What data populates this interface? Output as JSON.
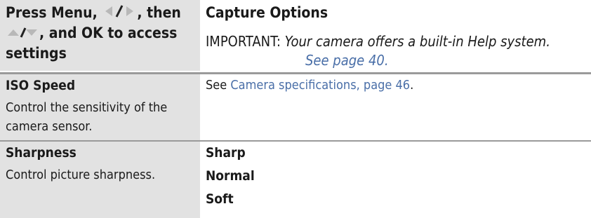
{
  "header": {
    "left_title_1": "Press Menu,",
    "left_title_2": ", then",
    "left_title_3": ", and OK to access",
    "left_title_4": "settings",
    "right_title": "Capture Options",
    "important_label": "IMPORTANT:",
    "important_note": "Your camera offers a built-in Help system.",
    "important_link": "See page 40."
  },
  "rows": [
    {
      "name": "ISO Speed",
      "description": "Control the sensitivity of the camera sensor.",
      "value_prefix": "See ",
      "value_link": "Camera specifications, page 46",
      "value_suffix": "."
    },
    {
      "name": "Sharpness",
      "description": "Control picture sharpness.",
      "options": [
        "Sharp",
        "Normal",
        "Soft"
      ]
    }
  ],
  "colors": {
    "shaded_cell": "#e2e2e2",
    "rule": "#9a9a9a",
    "link": "#4a6fa8",
    "arrow_gray": "#b8b8b8"
  }
}
